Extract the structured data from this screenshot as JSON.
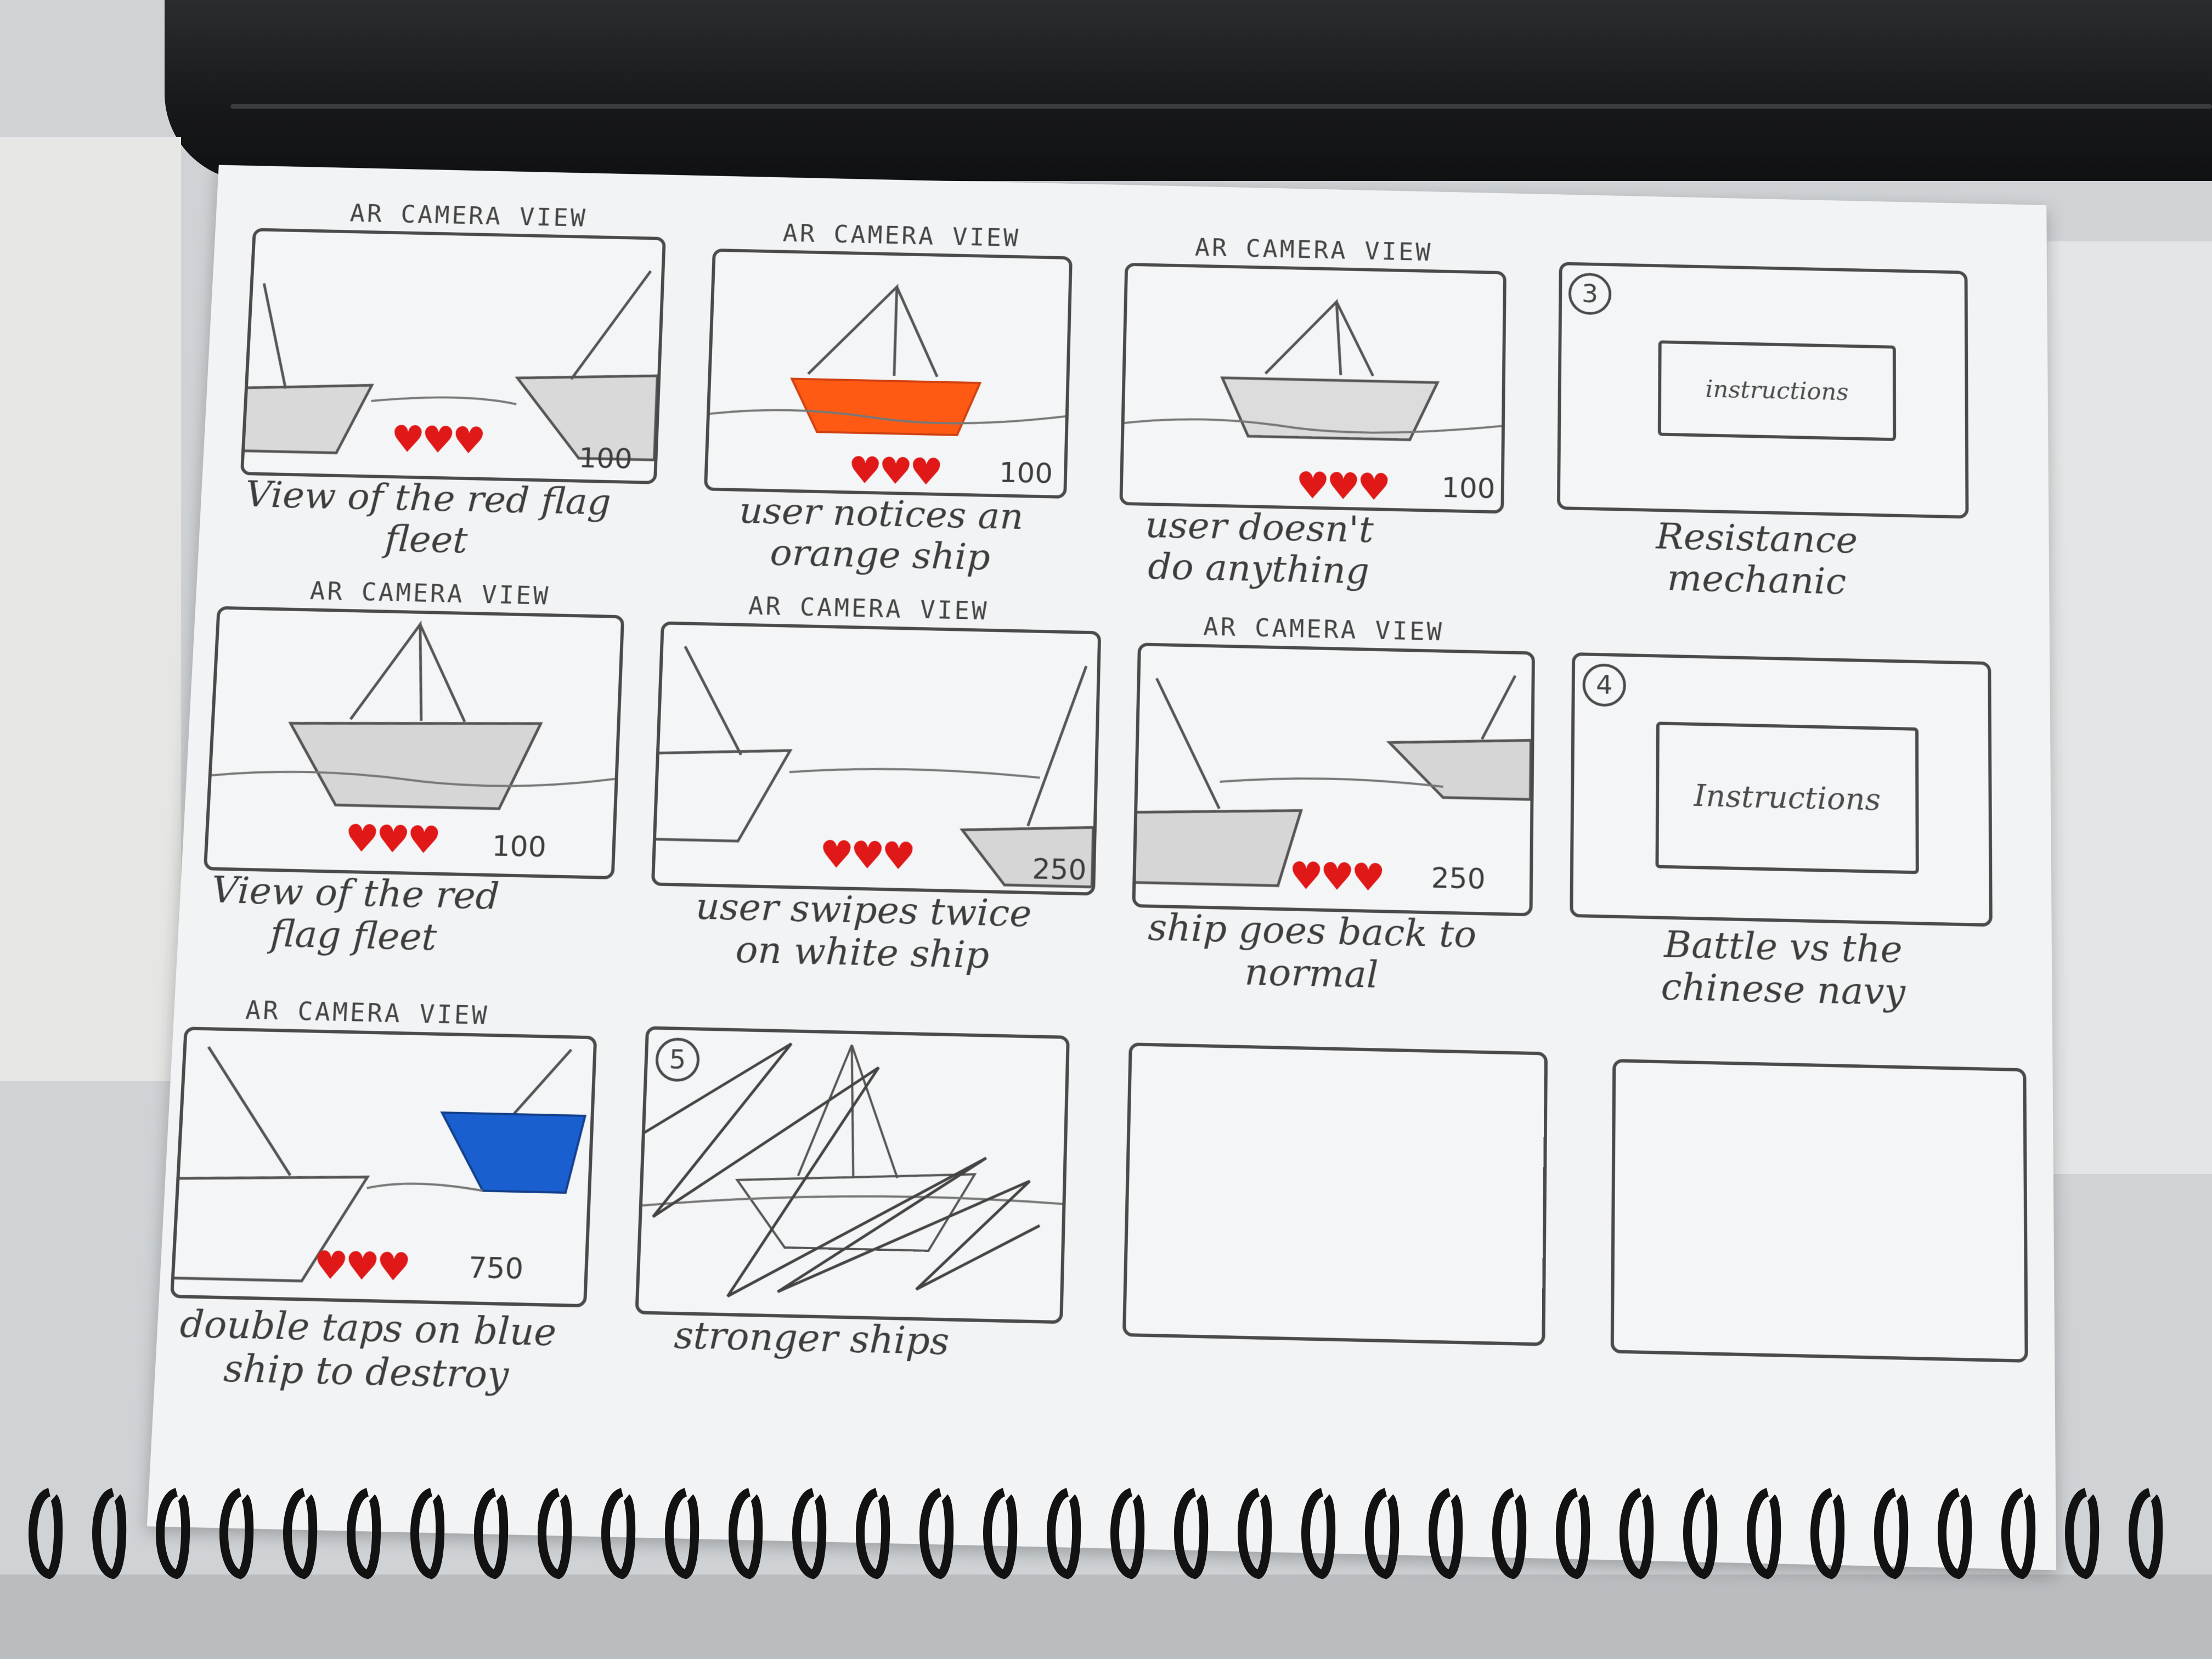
{
  "panel_header": "AR CAMERA VIEW",
  "panels": [
    {
      "caption": "View of the red flag fleet",
      "score": "100"
    },
    {
      "caption": "user notices an orange ship",
      "score": "100"
    },
    {
      "caption": "user doesn't do anything",
      "score": "100"
    },
    {
      "number": "3",
      "instructions": "instructions",
      "caption": "Resistance mechanic"
    },
    {
      "caption": "View of the red flag fleet",
      "score": "100"
    },
    {
      "caption": "user swipes twice on white ship",
      "score": "250"
    },
    {
      "caption": "ship goes back to normal",
      "score": "250"
    },
    {
      "number": "4",
      "instructions": "Instructions",
      "caption": "Battle vs the chinese navy"
    },
    {
      "caption": "double taps on blue ship to destroy",
      "score": "750"
    },
    {
      "number": "5",
      "caption": "stronger ships"
    }
  ],
  "hearts": "♥♥♥",
  "colors": {
    "heart": "#e01818",
    "orange_ship": "#ff5a14",
    "blue_ship": "#1a5fd0",
    "pencil": "#4a4a4a"
  }
}
